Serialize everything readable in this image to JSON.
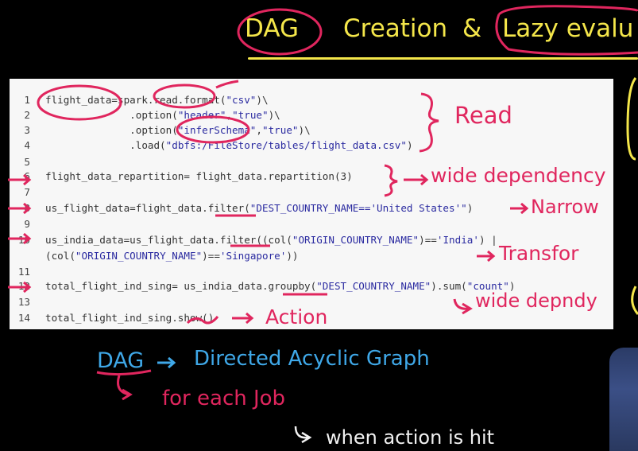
{
  "header": {
    "word1": "DAG",
    "word2": "Creation",
    "word3": "&",
    "word4": "Lazy evalu"
  },
  "code_lines": [
    {
      "num": "1",
      "parts": [
        {
          "t": "flight_data=spark.read.format(",
          "s": false
        },
        {
          "t": "\"csv\"",
          "s": true
        },
        {
          "t": ")\\",
          "s": false
        }
      ]
    },
    {
      "num": "2",
      "parts": [
        {
          "t": "              .option(",
          "s": false
        },
        {
          "t": "\"header\"",
          "s": true
        },
        {
          "t": ",",
          "s": false
        },
        {
          "t": "\"true\"",
          "s": true
        },
        {
          "t": ")\\",
          "s": false
        }
      ]
    },
    {
      "num": "3",
      "parts": [
        {
          "t": "              .option(",
          "s": false
        },
        {
          "t": "\"inferSchema\"",
          "s": true
        },
        {
          "t": ",",
          "s": false
        },
        {
          "t": "\"true\"",
          "s": true
        },
        {
          "t": ")\\",
          "s": false
        }
      ]
    },
    {
      "num": "4",
      "parts": [
        {
          "t": "              .load(",
          "s": false
        },
        {
          "t": "\"dbfs:/FileStore/tables/flight_data.csv\"",
          "s": true
        },
        {
          "t": ")",
          "s": false
        }
      ]
    },
    {
      "num": "5",
      "parts": []
    },
    {
      "num": "6",
      "parts": [
        {
          "t": "flight_data_repartition= flight_data.repartition(3)",
          "s": false
        }
      ]
    },
    {
      "num": "7",
      "parts": []
    },
    {
      "num": "8",
      "parts": [
        {
          "t": "us_flight_data=flight_data.filter(",
          "s": false
        },
        {
          "t": "\"DEST_COUNTRY_NAME=='United States'\"",
          "s": true
        },
        {
          "t": ")",
          "s": false
        }
      ]
    },
    {
      "num": "9",
      "parts": []
    },
    {
      "num": "10",
      "parts": [
        {
          "t": "us_india_data=us_flight_data.filter((col(",
          "s": false
        },
        {
          "t": "\"ORIGIN_COUNTRY_NAME\"",
          "s": true
        },
        {
          "t": ")==",
          "s": false
        },
        {
          "t": "'India'",
          "s": true
        },
        {
          "t": ") |",
          "s": false
        }
      ]
    },
    {
      "num": "",
      "parts": [
        {
          "t": "(col(",
          "s": false
        },
        {
          "t": "\"ORIGIN_COUNTRY_NAME\"",
          "s": true
        },
        {
          "t": ")==",
          "s": false
        },
        {
          "t": "'Singapore'",
          "s": true
        },
        {
          "t": "))",
          "s": false
        }
      ]
    },
    {
      "num": "11",
      "parts": []
    },
    {
      "num": "12",
      "parts": [
        {
          "t": "total_flight_ind_sing= us_india_data.groupby(",
          "s": false
        },
        {
          "t": "\"DEST_COUNTRY_NAME\"",
          "s": true
        },
        {
          "t": ").sum(",
          "s": false
        },
        {
          "t": "\"count\"",
          "s": true
        },
        {
          "t": ")",
          "s": false
        }
      ]
    },
    {
      "num": "13",
      "parts": []
    },
    {
      "num": "14",
      "parts": [
        {
          "t": "total_flight_ind_sing.show()",
          "s": false
        }
      ]
    }
  ],
  "annotations": {
    "read": "Read",
    "wide_dependency": "wide dependency",
    "narrow": "Narrow",
    "transfor": "Transfor",
    "wide_depndy": "wide depndy",
    "action": "Action",
    "dag_abbrev": "DAG",
    "dag_full": "Directed Acyclic Graph",
    "for_each_job": "for each Job",
    "when_action_hit": "when action is hit"
  },
  "colors": {
    "title_yellow": "#f4e64a",
    "pen_red": "#e0265e",
    "pen_blue": "#3fa8e8",
    "panel_bg": "#f7f7f7",
    "string_blue": "#2a2aa0"
  }
}
